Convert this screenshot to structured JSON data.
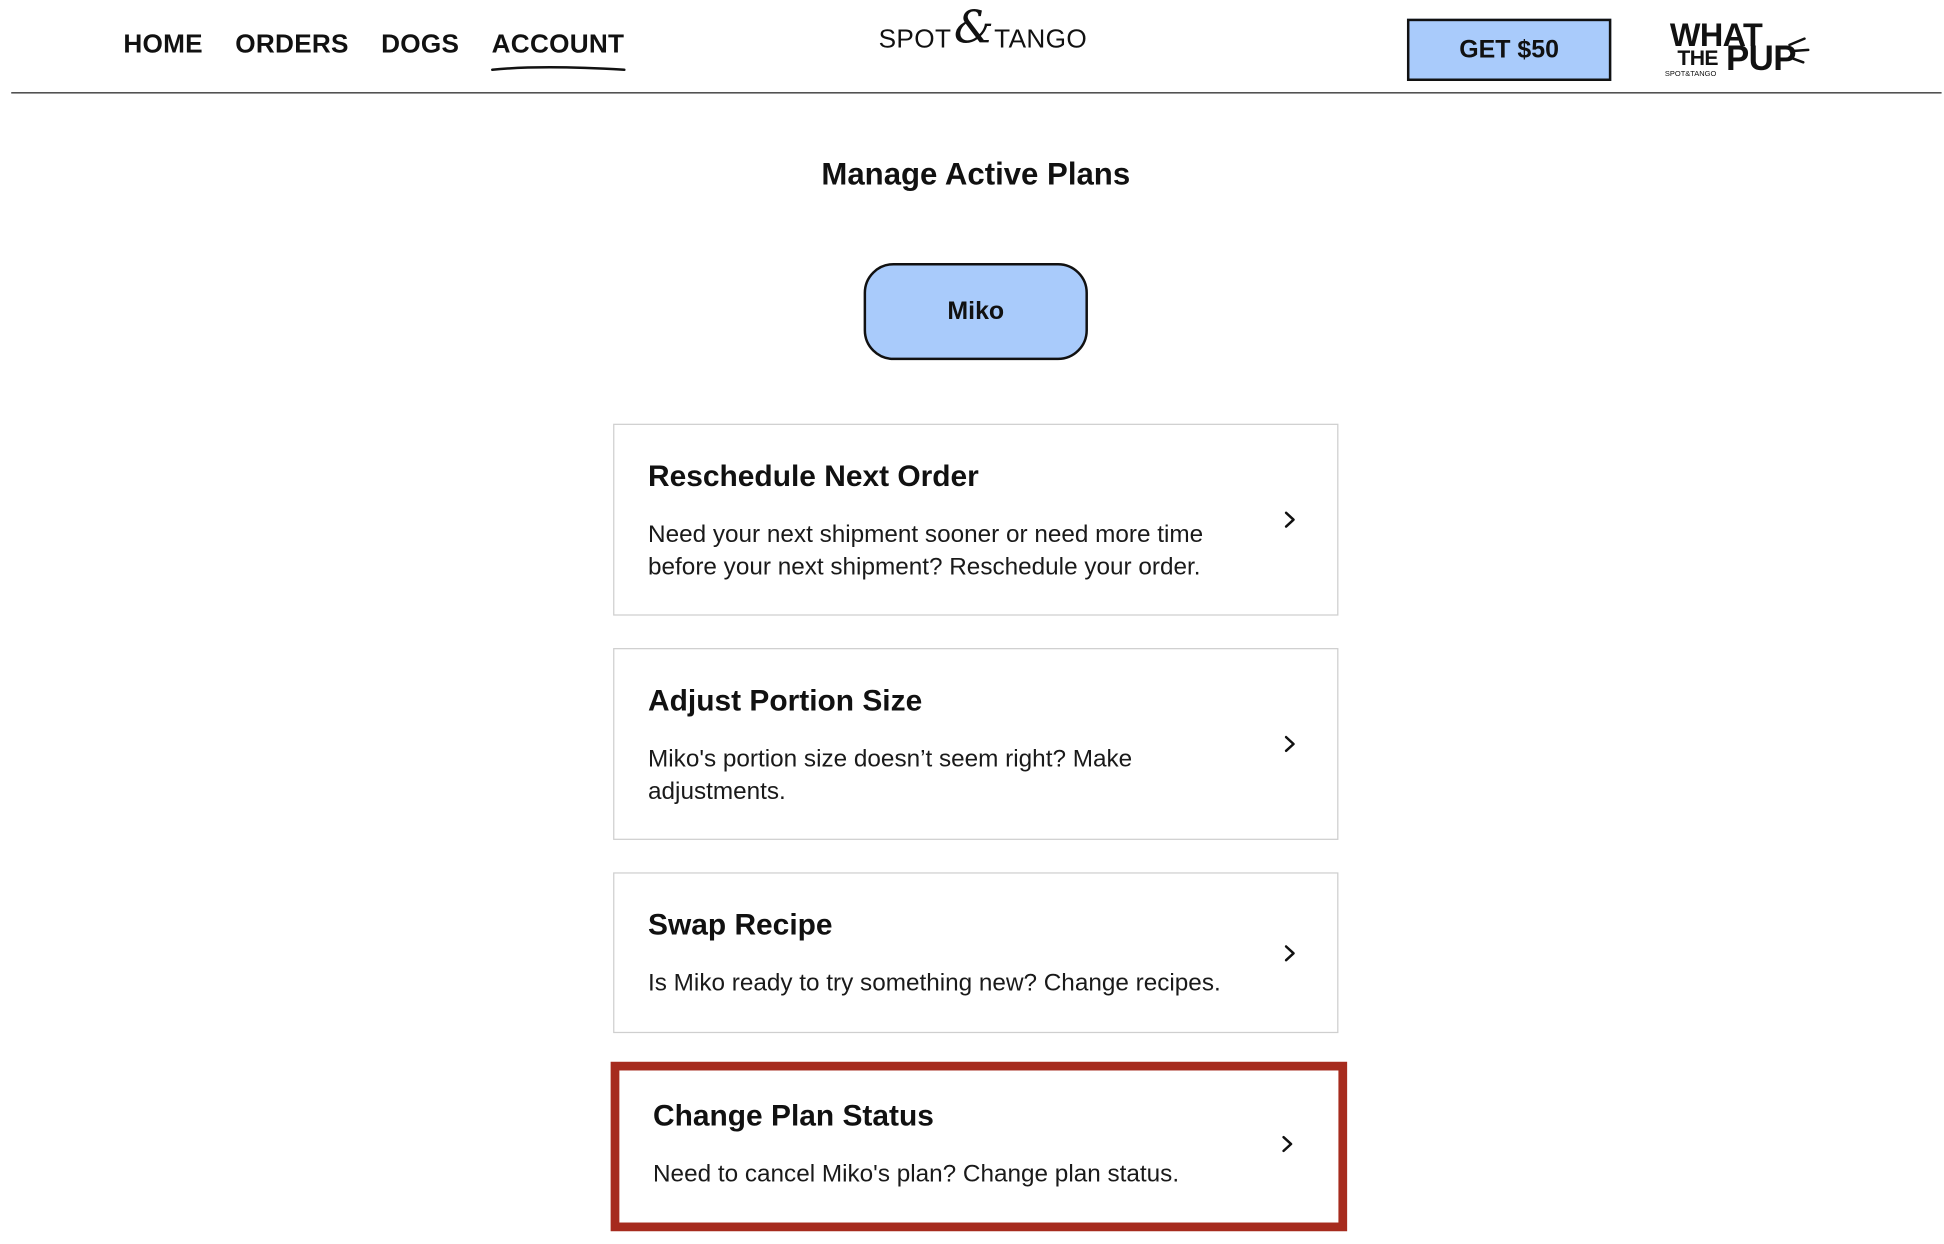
{
  "nav": {
    "links": [
      {
        "label": "HOME"
      },
      {
        "label": "ORDERS"
      },
      {
        "label": "DOGS"
      },
      {
        "label": "ACCOUNT"
      }
    ],
    "brand": {
      "left": "SPOT",
      "amp": "&",
      "right": "TANGO"
    },
    "cta_label": "GET $50",
    "wtp_logo": {
      "line1": "WHAT",
      "line2": "THE",
      "line3": "PUP",
      "tagline": "SPOT&TANGO"
    }
  },
  "main": {
    "title": "Manage Active Plans",
    "dog_name": "Miko",
    "cards": [
      {
        "title": "Reschedule Next Order",
        "description": "Need your next shipment sooner or need more time before your next shipment? Reschedule your order."
      },
      {
        "title": "Adjust Portion Size",
        "description": "Miko's portion size doesn’t seem right? Make adjustments."
      },
      {
        "title": "Swap Recipe",
        "description": "Is Miko ready to try something new? Change recipes."
      },
      {
        "title": "Change Plan Status",
        "description": "Need to cancel Miko's plan? Change plan status."
      }
    ]
  },
  "colors": {
    "accent_blue": "#a9cbfb",
    "highlight_border": "#a62b1e",
    "text": "#111111"
  }
}
